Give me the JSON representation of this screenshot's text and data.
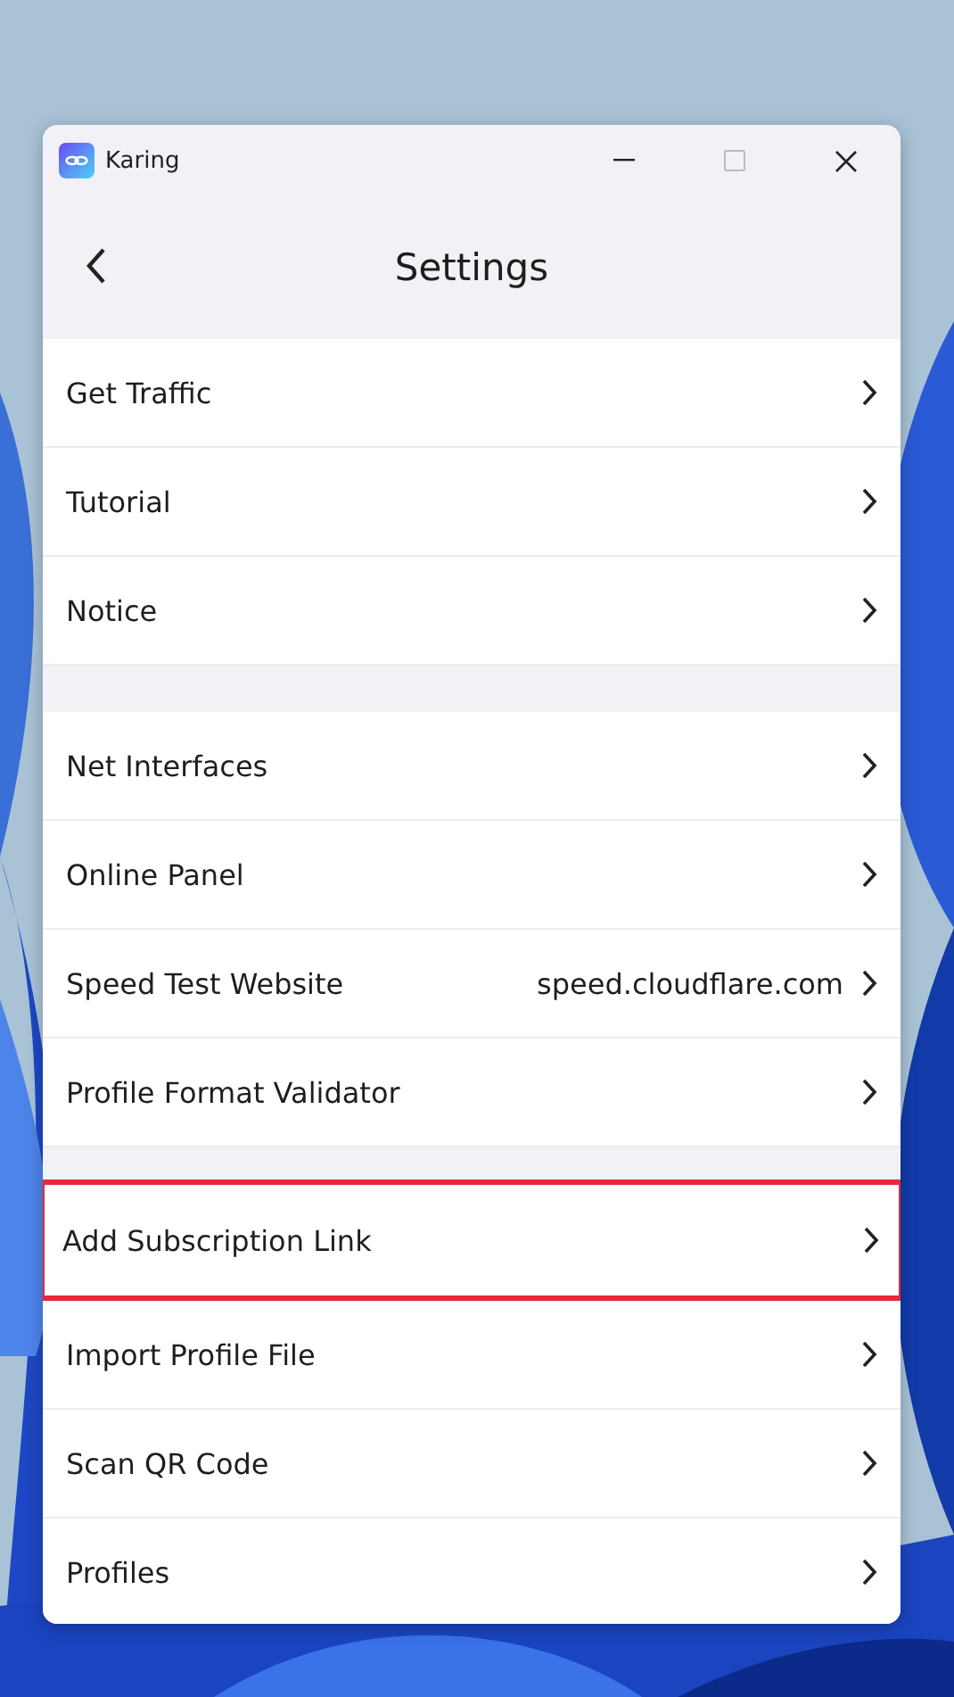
{
  "window": {
    "title": "Karing"
  },
  "header": {
    "title": "Settings"
  },
  "groups": [
    {
      "items": [
        {
          "label": "Get Traffic",
          "highlighted": false
        },
        {
          "label": "Tutorial",
          "highlighted": false
        },
        {
          "label": "Notice",
          "highlighted": false
        }
      ]
    },
    {
      "items": [
        {
          "label": "Net Interfaces",
          "highlighted": false
        },
        {
          "label": "Online Panel",
          "highlighted": false
        },
        {
          "label": "Speed Test Website",
          "value": "speed.cloudflare.com",
          "highlighted": false
        },
        {
          "label": "Profile Format Validator",
          "highlighted": false
        }
      ]
    },
    {
      "items": [
        {
          "label": "Add Subscription Link",
          "highlighted": true
        },
        {
          "label": "Import Profile File",
          "highlighted": false
        },
        {
          "label": "Scan QR Code",
          "highlighted": false
        },
        {
          "label": "Profiles",
          "highlighted": false
        }
      ]
    }
  ]
}
